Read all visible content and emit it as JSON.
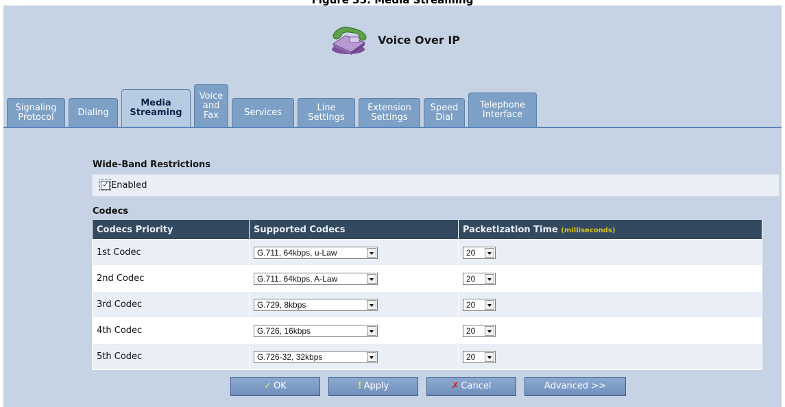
{
  "caption": "Figure 35: Media Streaming",
  "header": {
    "title": "Voice Over IP"
  },
  "tabs": [
    {
      "label": "Signaling\nProtocol"
    },
    {
      "label": "Dialing"
    },
    {
      "label": "Media\nStreaming"
    },
    {
      "label": "Voice\nand\nFax"
    },
    {
      "label": "Services"
    },
    {
      "label": "Line\nSettings"
    },
    {
      "label": "Extension\nSettings"
    },
    {
      "label": "Speed\nDial"
    },
    {
      "label": "Telephone\nInterface"
    }
  ],
  "active_tab": "Media Streaming",
  "wideband": {
    "title": "Wide-Band Restrictions",
    "enabled_label": "Enabled",
    "enabled_checked": true
  },
  "codecs": {
    "title": "Codecs",
    "headers": {
      "priority": "Codecs Priority",
      "supported": "Supported Codecs",
      "ptime": "Packetization Time",
      "ptime_unit": "(milliseconds)"
    },
    "rows": [
      {
        "priority": "1st Codec",
        "codec": "G.711, 64kbps, u-Law",
        "ptime": "20"
      },
      {
        "priority": "2nd Codec",
        "codec": "G.711, 64kbps, A-Law",
        "ptime": "20"
      },
      {
        "priority": "3rd Codec",
        "codec": "G.729, 8kbps",
        "ptime": "20"
      },
      {
        "priority": "4th Codec",
        "codec": "G.726, 16kbps",
        "ptime": "20"
      },
      {
        "priority": "5th Codec",
        "codec": "G.726-32, 32kbps",
        "ptime": "20"
      }
    ]
  },
  "buttons": {
    "ok": "OK",
    "apply": "Apply",
    "cancel": "Cancel",
    "advanced": "Advanced >>"
  },
  "icons": {
    "ok": "checkmark-icon",
    "apply": "exclamation-icon",
    "cancel": "x-mark-icon",
    "header": "voip-phone-icon"
  },
  "colors": {
    "panel_bg": "#c6d3e4",
    "tab": "#7da0c6",
    "tab_active": "#b7cbe2",
    "table_header": "#334960",
    "unit_text": "#d8c41a"
  }
}
